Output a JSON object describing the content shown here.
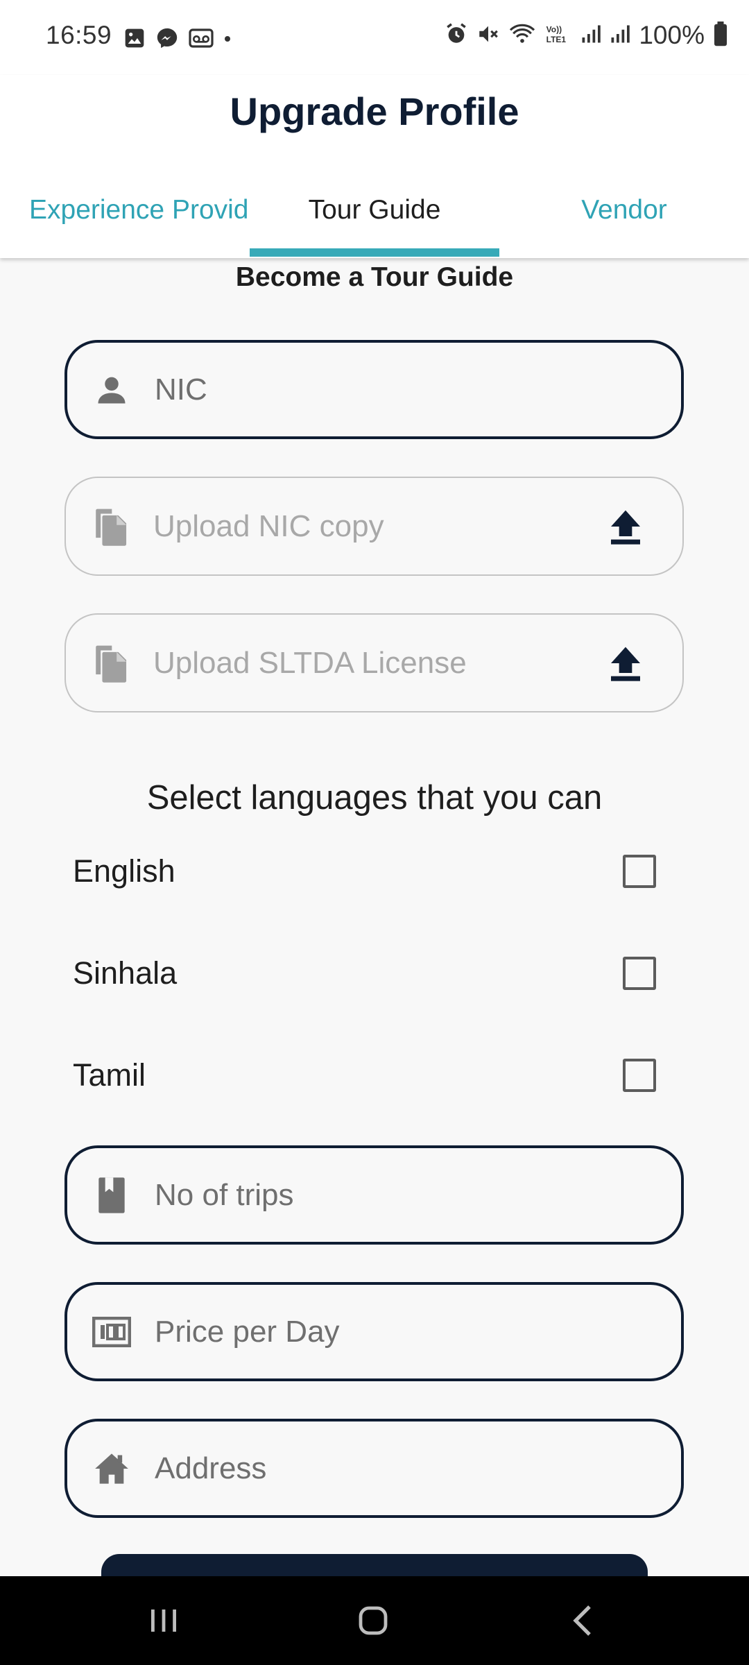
{
  "status_bar": {
    "time": "16:59",
    "battery": "100%",
    "left_icons": [
      "image-icon",
      "messenger-icon",
      "voicemail-icon",
      "dot-icon"
    ],
    "right_icons": [
      "alarm-icon",
      "mute-icon",
      "wifi-icon",
      "volte-icon",
      "signal-icon",
      "signal-icon",
      "battery-icon"
    ]
  },
  "header": {
    "title": "Upgrade Profile",
    "tabs": [
      {
        "label": "Experience Provider",
        "selected": false
      },
      {
        "label": "Tour Guide",
        "selected": true
      },
      {
        "label": "Vendor",
        "selected": false
      }
    ]
  },
  "form": {
    "section_title": "Become a Tour Guide",
    "nic": {
      "placeholder": "NIC",
      "icon": "person-icon"
    },
    "upload_nic": {
      "placeholder": "Upload NIC copy",
      "icon": "file-copy-icon",
      "action_icon": "upload-icon"
    },
    "upload_license": {
      "placeholder": "Upload SLTDA License",
      "icon": "file-copy-icon",
      "action_icon": "upload-icon"
    },
    "languages_title": "Select languages that you can",
    "languages": [
      {
        "label": "English",
        "checked": false
      },
      {
        "label": "Sinhala",
        "checked": false
      },
      {
        "label": "Tamil",
        "checked": false
      }
    ],
    "trips": {
      "placeholder": "No of trips",
      "icon": "book-icon"
    },
    "price": {
      "placeholder": "Price per Day",
      "icon": "money-icon"
    },
    "address": {
      "placeholder": "Address",
      "icon": "home-icon"
    }
  },
  "nav_bar": {
    "buttons": [
      "recents-icon",
      "home-icon",
      "back-icon"
    ]
  },
  "colors": {
    "primary_dark": "#0f1d33",
    "accent_teal": "#38aab8",
    "tab_inactive": "#2fa3b5",
    "background": "#f8f8f8"
  }
}
